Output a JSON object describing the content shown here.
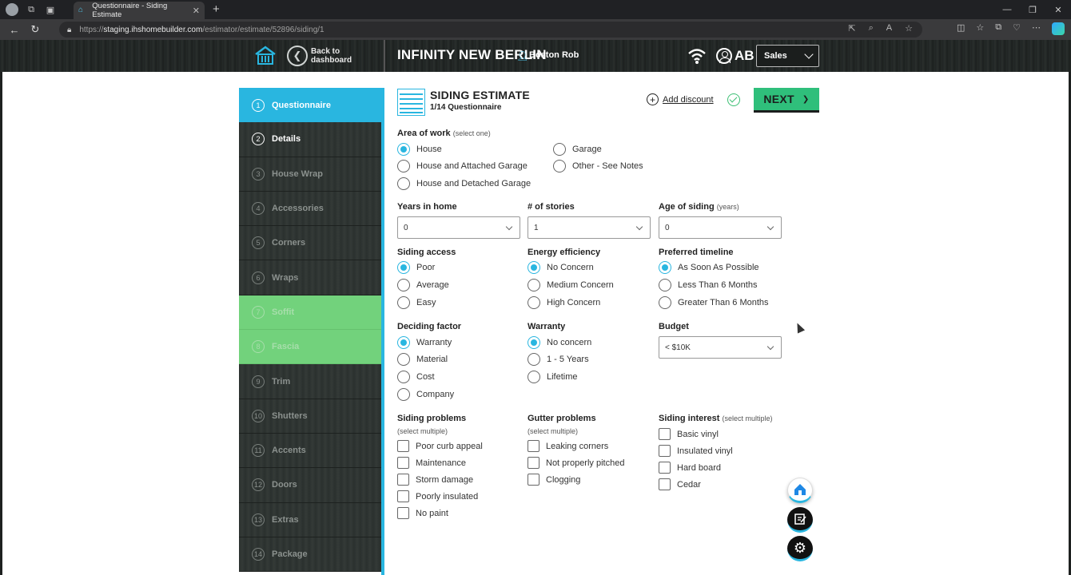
{
  "browser": {
    "tab_title": "Questionnaire - Siding Estimate",
    "url_prefix": "https://",
    "url_domain": "staging.ihshomebuilder.com",
    "url_path": "/estimator/estimate/52896/siding/1"
  },
  "header": {
    "back_label_1": "Back to",
    "back_label_2": "dashboard",
    "company": "INFINITY NEW BERLIN",
    "user": "Boston Rob",
    "initials": "AB",
    "role": "Sales"
  },
  "steps": [
    {
      "num": "1",
      "label": "Questionnaire"
    },
    {
      "num": "2",
      "label": "Details"
    },
    {
      "num": "3",
      "label": "House Wrap"
    },
    {
      "num": "4",
      "label": "Accessories"
    },
    {
      "num": "5",
      "label": "Corners"
    },
    {
      "num": "6",
      "label": "Wraps"
    },
    {
      "num": "7",
      "label": "Soffit"
    },
    {
      "num": "8",
      "label": "Fascia"
    },
    {
      "num": "9",
      "label": "Trim"
    },
    {
      "num": "10",
      "label": "Shutters"
    },
    {
      "num": "11",
      "label": "Accents"
    },
    {
      "num": "12",
      "label": "Doors"
    },
    {
      "num": "13",
      "label": "Extras"
    },
    {
      "num": "14",
      "label": "Package"
    }
  ],
  "estimate": {
    "title": "SIDING ESTIMATE",
    "subtitle": "1/14 Questionnaire",
    "add_discount": "Add discount",
    "next": "NEXT"
  },
  "form": {
    "area": {
      "label": "Area of work",
      "hint": "(select one)",
      "options": [
        "House",
        "House and Attached Garage",
        "House and Detached Garage",
        "Garage",
        "Other - See Notes"
      ],
      "selected": "House"
    },
    "years_in_home": {
      "label": "Years in home",
      "value": "0"
    },
    "stories": {
      "label": "# of stories",
      "value": "1"
    },
    "age_of_siding": {
      "label": "Age of siding",
      "hint": "(years)",
      "value": "0"
    },
    "siding_access": {
      "label": "Siding access",
      "options": [
        "Poor",
        "Average",
        "Easy"
      ],
      "selected": "Poor"
    },
    "energy_efficiency": {
      "label": "Energy efficiency",
      "options": [
        "No Concern",
        "Medium Concern",
        "High Concern"
      ],
      "selected": "No Concern"
    },
    "preferred_timeline": {
      "label": "Preferred timeline",
      "options": [
        "As Soon As Possible",
        "Less Than 6 Months",
        "Greater Than 6 Months"
      ],
      "selected": "As Soon As Possible"
    },
    "deciding_factor": {
      "label": "Deciding factor",
      "options": [
        "Warranty",
        "Material",
        "Cost",
        "Company"
      ],
      "selected": "Warranty"
    },
    "warranty": {
      "label": "Warranty",
      "options": [
        "No concern",
        "1 - 5 Years",
        "Lifetime"
      ],
      "selected": "No concern"
    },
    "budget": {
      "label": "Budget",
      "value": "< $10K"
    },
    "siding_problems": {
      "label": "Siding problems",
      "hint": "(select multiple)",
      "options": [
        "Poor curb appeal",
        "Maintenance",
        "Storm damage",
        "Poorly insulated",
        "No paint"
      ]
    },
    "gutter_problems": {
      "label": "Gutter problems",
      "hint": "(select multiple)",
      "options": [
        "Leaking corners",
        "Not properly pitched",
        "Clogging"
      ]
    },
    "siding_interest": {
      "label": "Siding interest",
      "hint": "(select multiple)",
      "options": [
        "Basic vinyl",
        "Insulated vinyl",
        "Hard board",
        "Cedar"
      ]
    }
  },
  "colors": {
    "accent": "#29b6e0",
    "next": "#2fbf7b",
    "complete": "#72d27c"
  }
}
